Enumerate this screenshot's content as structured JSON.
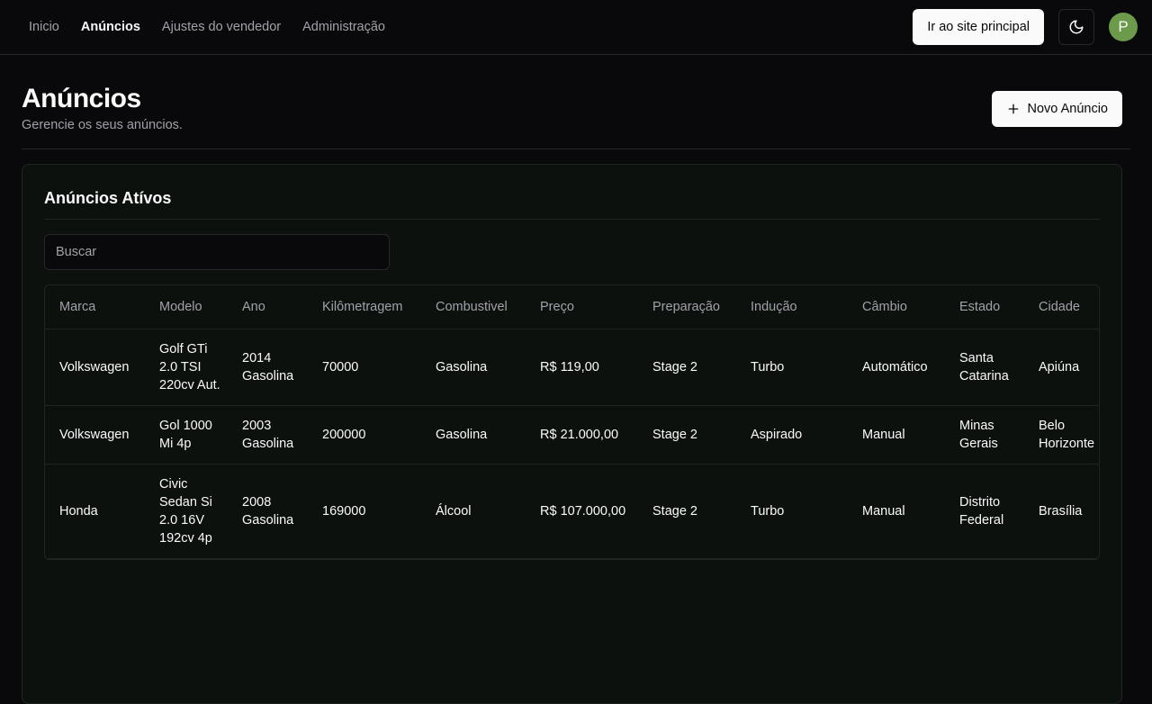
{
  "nav": {
    "items": [
      {
        "label": "Inicio",
        "active": false
      },
      {
        "label": "Anúncios",
        "active": true
      },
      {
        "label": "Ajustes do vendedor",
        "active": false
      },
      {
        "label": "Administração",
        "active": false
      }
    ],
    "main_site_button": "Ir ao site principal",
    "theme_toggle_icon": "moon-icon",
    "avatar_initial": "P"
  },
  "header": {
    "title": "Anúncios",
    "subtitle": "Gerencie os seus anúncios.",
    "new_button": "Novo Anúncio",
    "new_button_icon": "plus-icon"
  },
  "card": {
    "title": "Anúncios Atívos",
    "search_placeholder": "Buscar"
  },
  "table": {
    "columns": [
      "Marca",
      "Modelo",
      "Ano",
      "Kilômetragem",
      "Combustivel",
      "Preço",
      "Preparação",
      "Indução",
      "Câmbio",
      "Estado",
      "Cidade"
    ],
    "rows": [
      [
        "Volkswagen",
        "Golf GTi 2.0 TSI 220cv Aut.",
        "2014 Gasolina",
        "70000",
        "Gasolina",
        "R$ 119,00",
        "Stage 2",
        "Turbo",
        "Automático",
        "Santa Catarina",
        "Apiúna"
      ],
      [
        "Volkswagen",
        "Gol 1000 Mi 4p",
        "2003 Gasolina",
        "200000",
        "Gasolina",
        "R$ 21.000,00",
        "Stage 2",
        "Aspirado",
        "Manual",
        "Minas Gerais",
        "Belo Horizonte"
      ],
      [
        "Honda",
        "Civic Sedan Si 2.0 16V 192cv 4p",
        "2008 Gasolina",
        "169000",
        "Álcool",
        "R$ 107.000,00",
        "Stage 2",
        "Turbo",
        "Manual",
        "Distrito Federal",
        "Brasília"
      ]
    ]
  },
  "colors": {
    "background": "#09090b",
    "card": "#0c110e",
    "avatar": "#6a9a4a"
  }
}
